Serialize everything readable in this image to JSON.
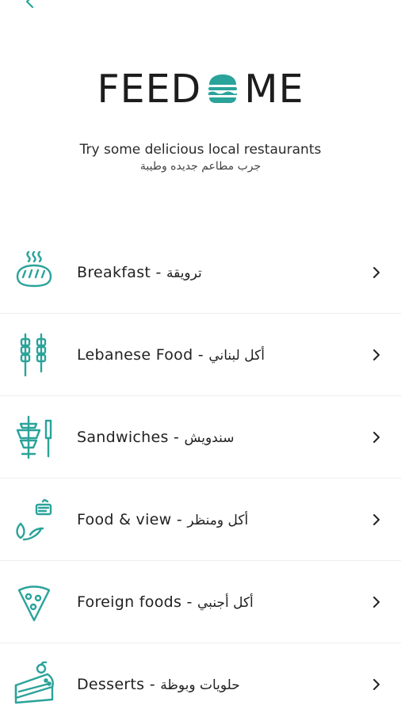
{
  "colors": {
    "accent": "#2aa39a",
    "text": "#222222",
    "divider": "#eeeeee",
    "background": "#ffffff"
  },
  "header": {
    "back_icon": "chevron-left-icon"
  },
  "logo": {
    "left": "FEED",
    "right": "ME",
    "icon": "burger-icon"
  },
  "tagline": {
    "english": "Try some delicious local restaurants",
    "arabic": "جرب مطاعم جديده وطيبة"
  },
  "categories": [
    {
      "label": "Breakfast - ",
      "label_ar": "ترويقة",
      "icon": "bread-icon"
    },
    {
      "label": "Lebanese Food - ",
      "label_ar": "أكل لبناني",
      "icon": "skewers-icon"
    },
    {
      "label": "Sandwiches - ",
      "label_ar": "سندويش",
      "icon": "shawarma-icon"
    },
    {
      "label": "Food & view - ",
      "label_ar": "أكل ومنظر",
      "icon": "food-view-icon"
    },
    {
      "label": "Foreign foods - ",
      "label_ar": "أكل أجنبي",
      "icon": "pizza-slice-icon"
    },
    {
      "label": "Desserts - ",
      "label_ar": "حلويات وبوظة",
      "icon": "cake-icon"
    }
  ]
}
